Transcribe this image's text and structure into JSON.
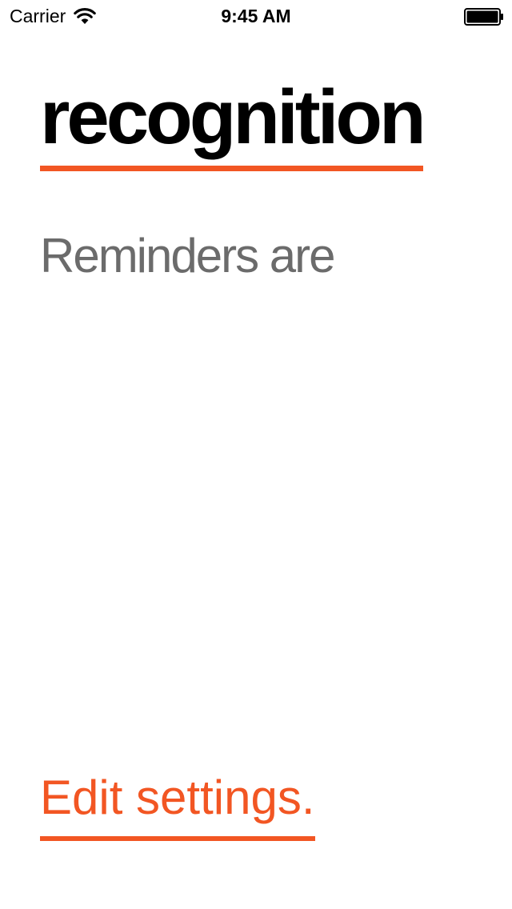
{
  "status_bar": {
    "carrier": "Carrier",
    "time": "9:45 AM",
    "wifi_icon": "wifi-icon",
    "battery_icon": "battery-icon",
    "battery_level": 1.0
  },
  "main": {
    "title": "recognition",
    "message": "Reminders are",
    "settings_link": "Edit settings."
  },
  "colors": {
    "accent": "#f25623",
    "title_text": "#000000",
    "body_text": "#6b6b6b",
    "background": "#ffffff"
  }
}
